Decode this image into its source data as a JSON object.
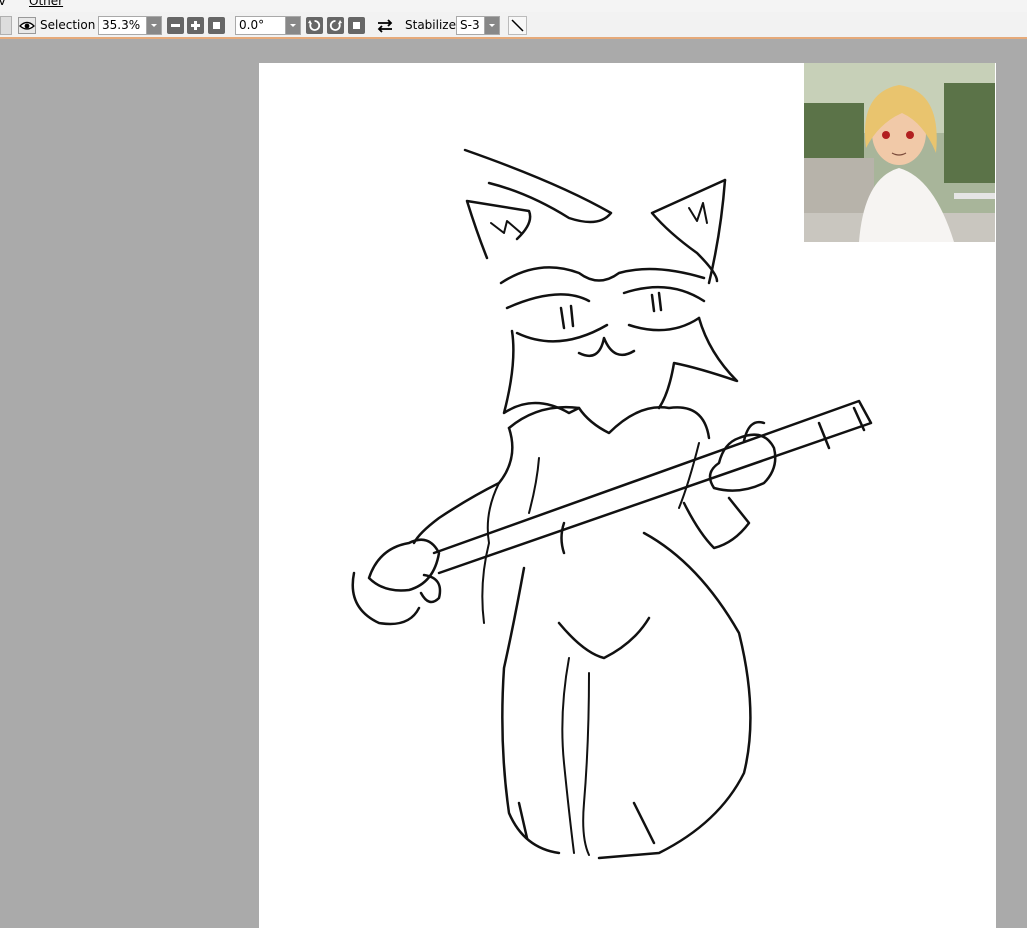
{
  "menubar": {
    "item_prev_fragment": "V",
    "item_other": "Other"
  },
  "toolbar": {
    "selection_label": "Selection",
    "zoom_value": "35.3%",
    "rotation_value": "0.0°",
    "stabilizer_label": "Stabilizer",
    "stabilizer_value": "S-3"
  },
  "icons": {
    "view_toggle": "eye-icon",
    "zoom_out": "minus-icon",
    "zoom_in": "plus-icon",
    "zoom_reset": "square-icon",
    "rotate_left": "rotate-ccw-icon",
    "rotate_right": "rotate-cw-icon",
    "rotate_reset": "square-icon",
    "flip": "flip-horizontal-icon",
    "pen": "line-tool-icon"
  },
  "colors": {
    "workspace_background": "#aaaaaa",
    "canvas_background": "#ffffff",
    "toolbar_background": "#f2f2f2",
    "toolbar_accent_line": "#e6aa7a"
  }
}
